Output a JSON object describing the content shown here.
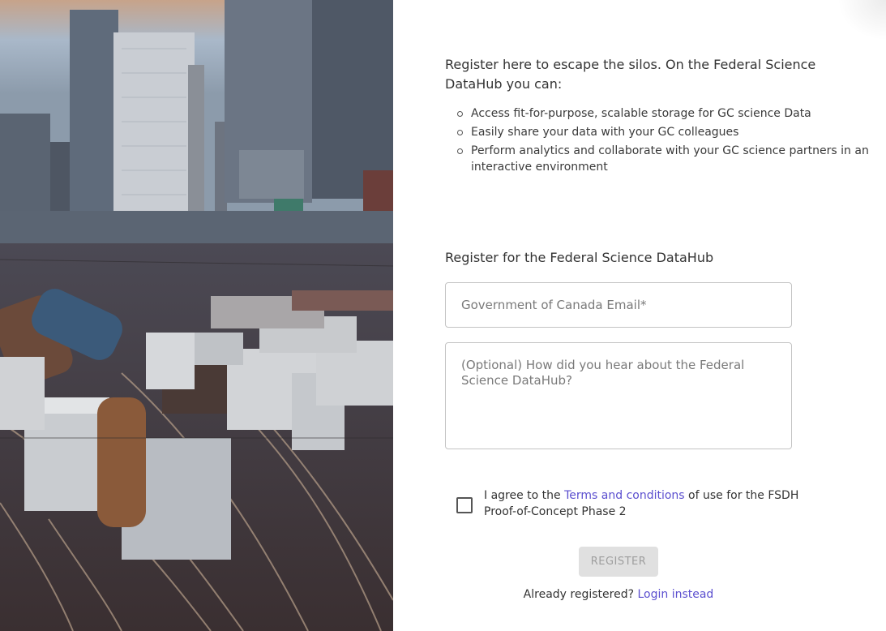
{
  "hero_image": {
    "description_icon": "rail-yard-city-photo"
  },
  "intro": {
    "text": "Register here to escape the silos. On the Federal Science DataHub you can:",
    "benefits": [
      "Access fit-for-purpose, scalable storage for GC science Data",
      "Easily share your data with your GC colleagues",
      "Perform analytics and collaborate with your GC science partners in an interactive environment"
    ]
  },
  "form": {
    "heading": "Register for the Federal Science DataHub",
    "email_placeholder": "Government of Canada Email*",
    "email_value": "",
    "hear_placeholder": "(Optional) How did you hear about the Federal Science DataHub?",
    "hear_value": "",
    "terms": {
      "checked": false,
      "prefix": "I agree to the ",
      "link": "Terms and conditions",
      "suffix": " of use for the FSDH Proof-of-Concept Phase 2"
    },
    "register_label": "REGISTER",
    "register_disabled": true
  },
  "login": {
    "prompt": "Already registered? ",
    "link": "Login instead"
  },
  "colors": {
    "link": "#5b4fcf",
    "disabled_button_bg": "#e0e0e0",
    "disabled_button_text": "#9e9e9e"
  }
}
